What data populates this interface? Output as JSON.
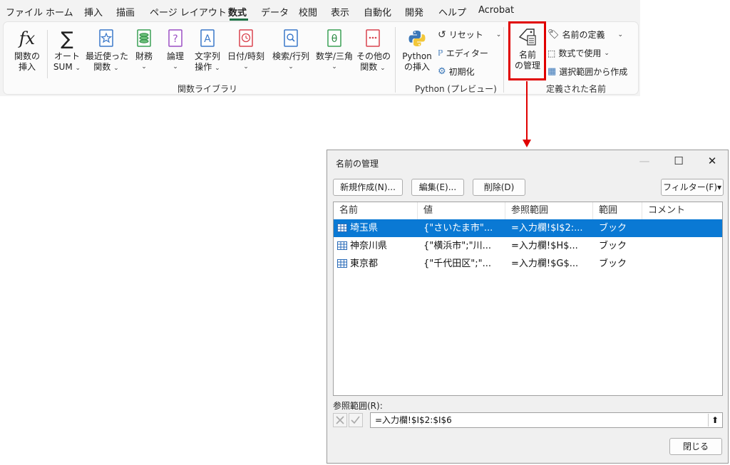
{
  "ribbon": {
    "tabs": [
      "ファイル",
      "ホーム",
      "挿入",
      "描画",
      "ページ レイアウト",
      "数式",
      "データ",
      "校閲",
      "表示",
      "自動化",
      "開発",
      "ヘルプ",
      "Acrobat"
    ],
    "function_library": {
      "insert_function": [
        "関数の",
        "挿入"
      ],
      "autosum": [
        "オート",
        "SUM"
      ],
      "recent": [
        "最近使った",
        "関数"
      ],
      "financial": "財務",
      "logical": "論理",
      "text": [
        "文字列",
        "操作"
      ],
      "datetime": "日付/時刻",
      "lookup": "検索/行列",
      "math": "数学/三角",
      "more": [
        "その他の",
        "関数"
      ],
      "group_label": "関数ライブラリ"
    },
    "python": {
      "insert": [
        "Python",
        "の挿入"
      ],
      "reset": "リセット",
      "editor": "エディター",
      "initialize": "初期化",
      "group_label": "Python (プレビュー)"
    },
    "defined_names": {
      "name_manager": [
        "名前",
        "の管理"
      ],
      "define_name": "名前の定義",
      "use_in_formula": "数式で使用",
      "create_from_selection": "選択範囲から作成",
      "group_label": "定義された名前"
    },
    "accent_color": "#1e7145",
    "highlight_color": "#e00000"
  },
  "dialog": {
    "title": "名前の管理",
    "buttons": {
      "new": "新規作成(N)...",
      "edit": "編集(E)...",
      "delete": "削除(D)",
      "filter": "フィルター(F)",
      "close": "閉じる"
    },
    "columns": [
      "名前",
      "値",
      "参照範囲",
      "範囲",
      "コメント"
    ],
    "rows": [
      {
        "name": "埼玉県",
        "value": "{\"さいたま市\"...",
        "ref": "=入力欄!$I$2:...",
        "scope": "ブック",
        "comment": "",
        "selected": true
      },
      {
        "name": "神奈川県",
        "value": "{\"横浜市\";\"川...",
        "ref": "=入力欄!$H$...",
        "scope": "ブック",
        "comment": "",
        "selected": false
      },
      {
        "name": "東京都",
        "value": "{\"千代田区\";\"...",
        "ref": "=入力欄!$G$...",
        "scope": "ブック",
        "comment": "",
        "selected": false
      }
    ],
    "refers_to_label": "参照範囲(R):",
    "refers_to_value": "=入力欄!$I$2:$I$6",
    "selection_color": "#0a79d4"
  }
}
